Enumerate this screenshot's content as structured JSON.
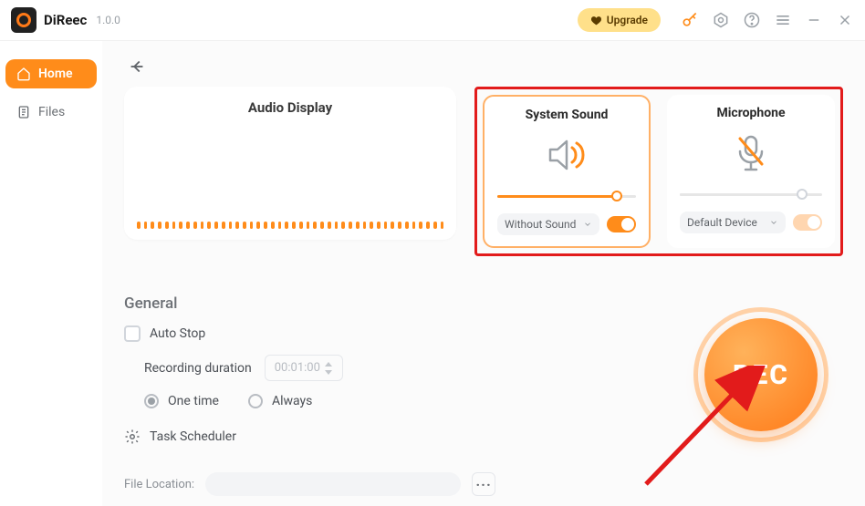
{
  "app": {
    "name": "DiReec",
    "version": "1.0.0"
  },
  "titlebar": {
    "upgrade_label": "Upgrade"
  },
  "sidebar": {
    "items": [
      {
        "label": "Home",
        "icon": "home-icon",
        "active": true
      },
      {
        "label": "Files",
        "icon": "files-icon",
        "active": false
      }
    ]
  },
  "audio_display": {
    "title": "Audio Display"
  },
  "system_sound": {
    "title": "System Sound",
    "selected_option": "Without Sound",
    "slider_percent": 86,
    "toggle_on": true
  },
  "microphone": {
    "title": "Microphone",
    "selected_option": "Default Device",
    "slider_percent": 86,
    "toggle_on": false
  },
  "general": {
    "heading": "General",
    "auto_stop_label": "Auto Stop",
    "duration_label": "Recording duration",
    "duration_value": "00:01:00",
    "one_time_label": "One time",
    "always_label": "Always",
    "task_scheduler_label": "Task Scheduler",
    "file_location_label": "File Location:"
  },
  "record_button": {
    "label": "REC"
  }
}
